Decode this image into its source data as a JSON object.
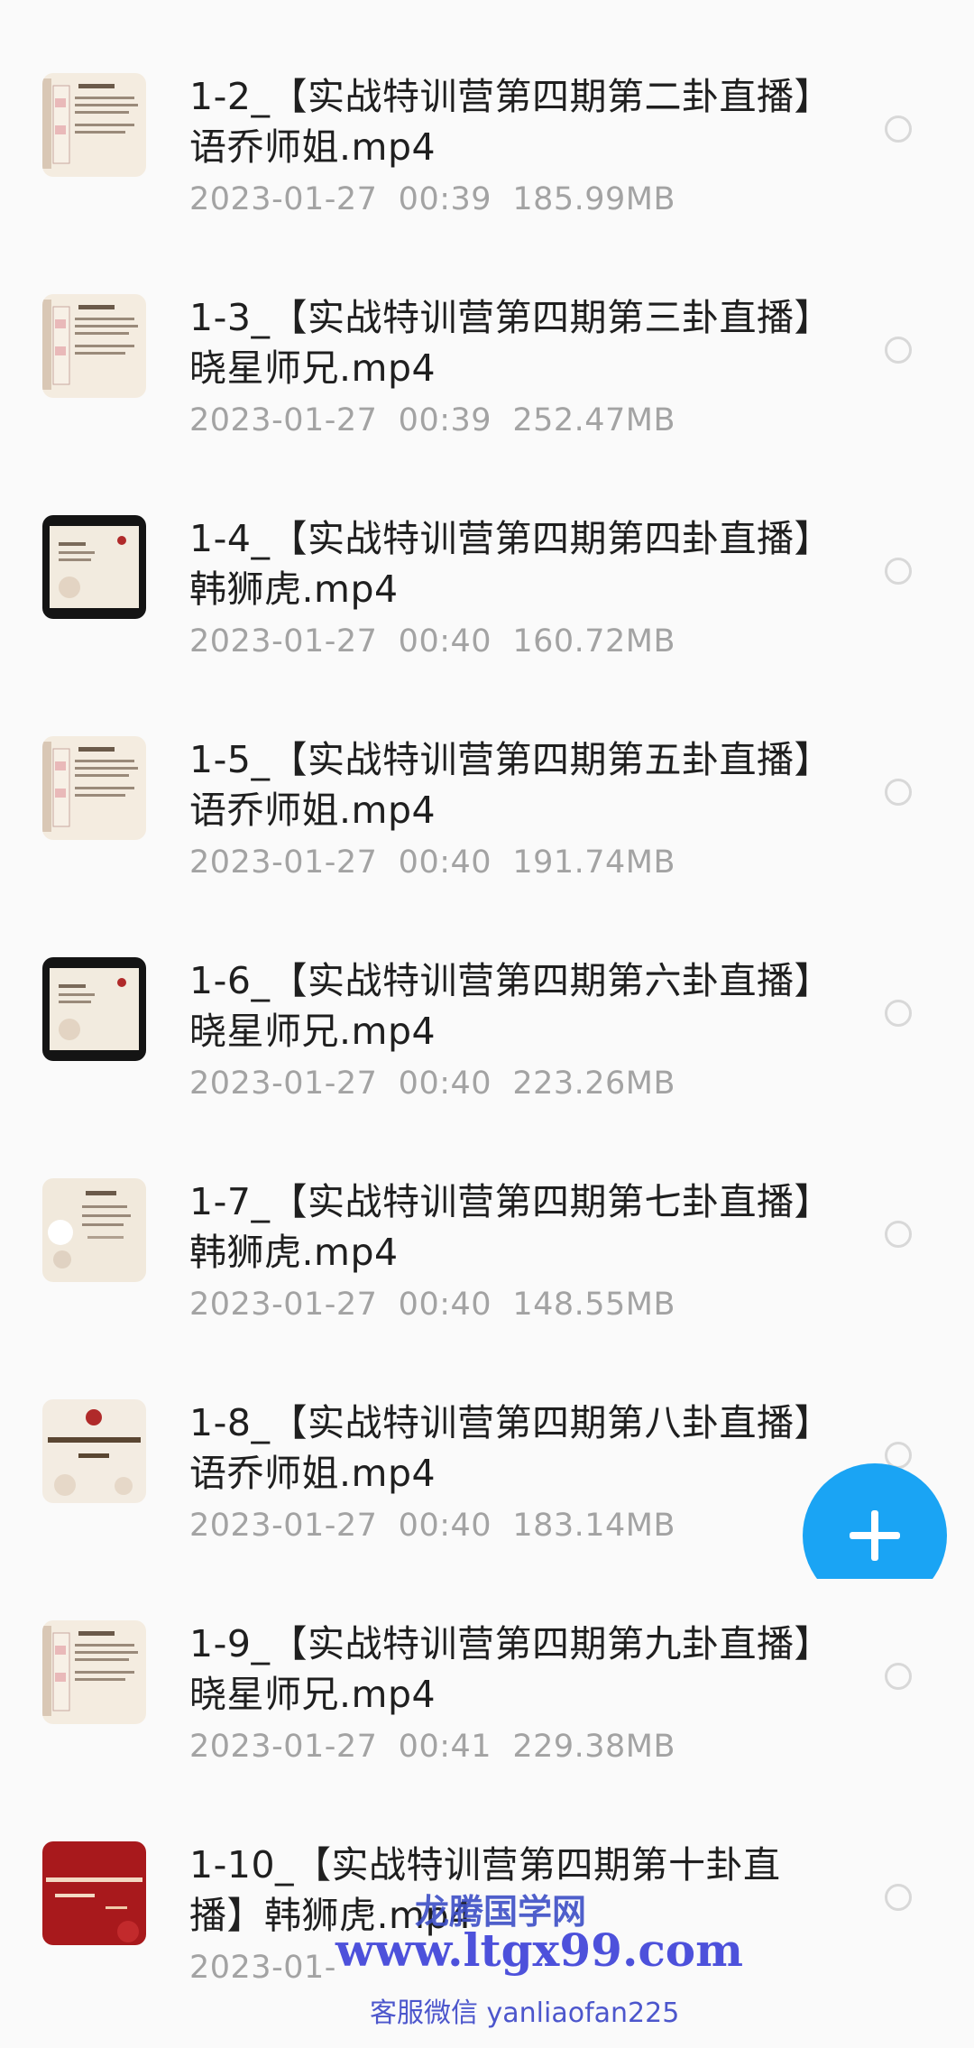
{
  "files": [
    {
      "title": "1-2_【实战特训营第四期第二卦直播】语乔师姐.mp4",
      "date": "2023-01-27",
      "time": "00:39",
      "size": "185.99MB",
      "thumb": "slide-cream"
    },
    {
      "title": "1-3_【实战特训营第四期第三卦直播】晓星师兄.mp4",
      "date": "2023-01-27",
      "time": "00:39",
      "size": "252.47MB",
      "thumb": "slide-cream"
    },
    {
      "title": "1-4_【实战特训营第四期第四卦直播】韩狮虎.mp4",
      "date": "2023-01-27",
      "time": "00:40",
      "size": "160.72MB",
      "thumb": "slide-dark"
    },
    {
      "title": "1-5_【实战特训营第四期第五卦直播】语乔师姐.mp4",
      "date": "2023-01-27",
      "time": "00:40",
      "size": "191.74MB",
      "thumb": "slide-cream"
    },
    {
      "title": "1-6_【实战特训营第四期第六卦直播】晓星师兄.mp4",
      "date": "2023-01-27",
      "time": "00:40",
      "size": "223.26MB",
      "thumb": "slide-dark"
    },
    {
      "title": "1-7_【实战特训营第四期第七卦直播】韩狮虎.mp4",
      "date": "2023-01-27",
      "time": "00:40",
      "size": "148.55MB",
      "thumb": "slide-plain"
    },
    {
      "title": "1-8_【实战特训营第四期第八卦直播】语乔师姐.mp4",
      "date": "2023-01-27",
      "time": "00:40",
      "size": "183.14MB",
      "thumb": "slide-cover"
    },
    {
      "title": "1-9_【实战特训营第四期第九卦直播】晓星师兄.mp4",
      "date": "2023-01-27",
      "time": "00:41",
      "size": "229.38MB",
      "thumb": "slide-cream"
    },
    {
      "title": "1-10_【实战特训营第四期第十卦直播】韩狮虎.mp4",
      "date": "2023-01-",
      "time": "",
      "size": "",
      "thumb": "slide-red"
    }
  ],
  "fab": {
    "icon": "plus-icon",
    "color": "#1aa4f4"
  },
  "watermark": {
    "line1": "龙腾国学网",
    "line2": "www.ltgx99.com",
    "line3": "客服微信 yanliaofan225"
  }
}
